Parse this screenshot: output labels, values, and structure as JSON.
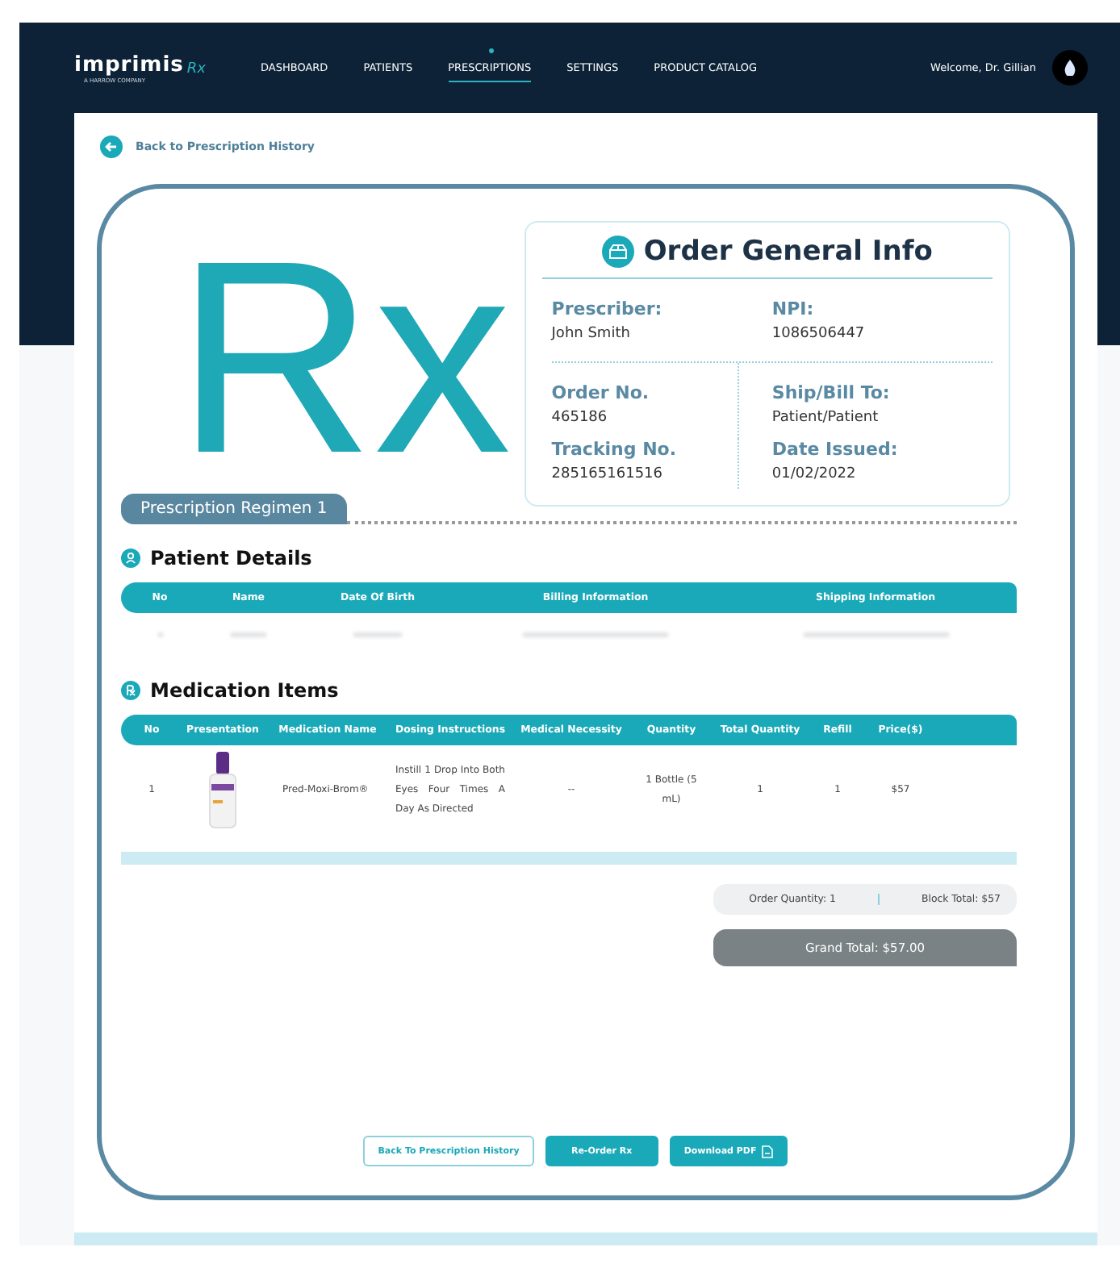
{
  "header": {
    "logo": {
      "name": "imprimis",
      "mark": "Rx",
      "tagline": "A HARROW COMPANY"
    },
    "nav": [
      {
        "label": "DASHBOARD",
        "selected": false
      },
      {
        "label": "PATIENTS",
        "selected": false
      },
      {
        "label": "PRESCRIPTIONS",
        "selected": true
      },
      {
        "label": "SETTINGS",
        "selected": false
      },
      {
        "label": "PRODUCT CATALOG",
        "selected": false
      }
    ],
    "welcome": "Welcome, Dr. Gillian"
  },
  "back_link": "Back to Prescription History",
  "rx_mark": "Rx",
  "order_info": {
    "title": "Order General Info",
    "fields": [
      {
        "label": "Prescriber:",
        "value": "John Smith"
      },
      {
        "label": "NPI:",
        "value": "1086506447"
      },
      {
        "label": "Order No.",
        "value": "465186"
      },
      {
        "label": "Ship/Bill To:",
        "value": "Patient/Patient"
      },
      {
        "label": "Tracking No.",
        "value": "285165161516"
      },
      {
        "label": "Date Issued:",
        "value": "01/02/2022"
      }
    ]
  },
  "regimen_tab": "Prescription Regimen 1",
  "patient_details": {
    "title": "Patient Details",
    "columns": [
      "No",
      "Name",
      "Date Of Birth",
      "Billing Information",
      "Shipping Information"
    ]
  },
  "medication_items": {
    "title": "Medication Items",
    "columns": [
      "No",
      "Presentation",
      "Medication Name",
      "Dosing Instructions",
      "Medical Necessity",
      "Quantity",
      "Total Quantity",
      "Refill",
      "Price($)"
    ],
    "rows": [
      {
        "no": "1",
        "name": "Pred-Moxi-Brom®",
        "dosing": "Instill 1 Drop Into Both Eyes Four Times A Day As Directed",
        "necessity": "--",
        "quantity": "1 Bottle (5 mL)",
        "total_quantity": "1",
        "refill": "1",
        "price": "$57"
      }
    ]
  },
  "summary": {
    "order_quantity": "Order Quantity: 1",
    "block_total": "Block Total: $57",
    "grand_total": "Grand Total: $57.00"
  },
  "buttons": [
    {
      "label": "Back To Prescription History",
      "kind": "outline"
    },
    {
      "label": "Re-Order Rx",
      "kind": "solid"
    },
    {
      "label": "Download PDF",
      "kind": "download"
    }
  ]
}
